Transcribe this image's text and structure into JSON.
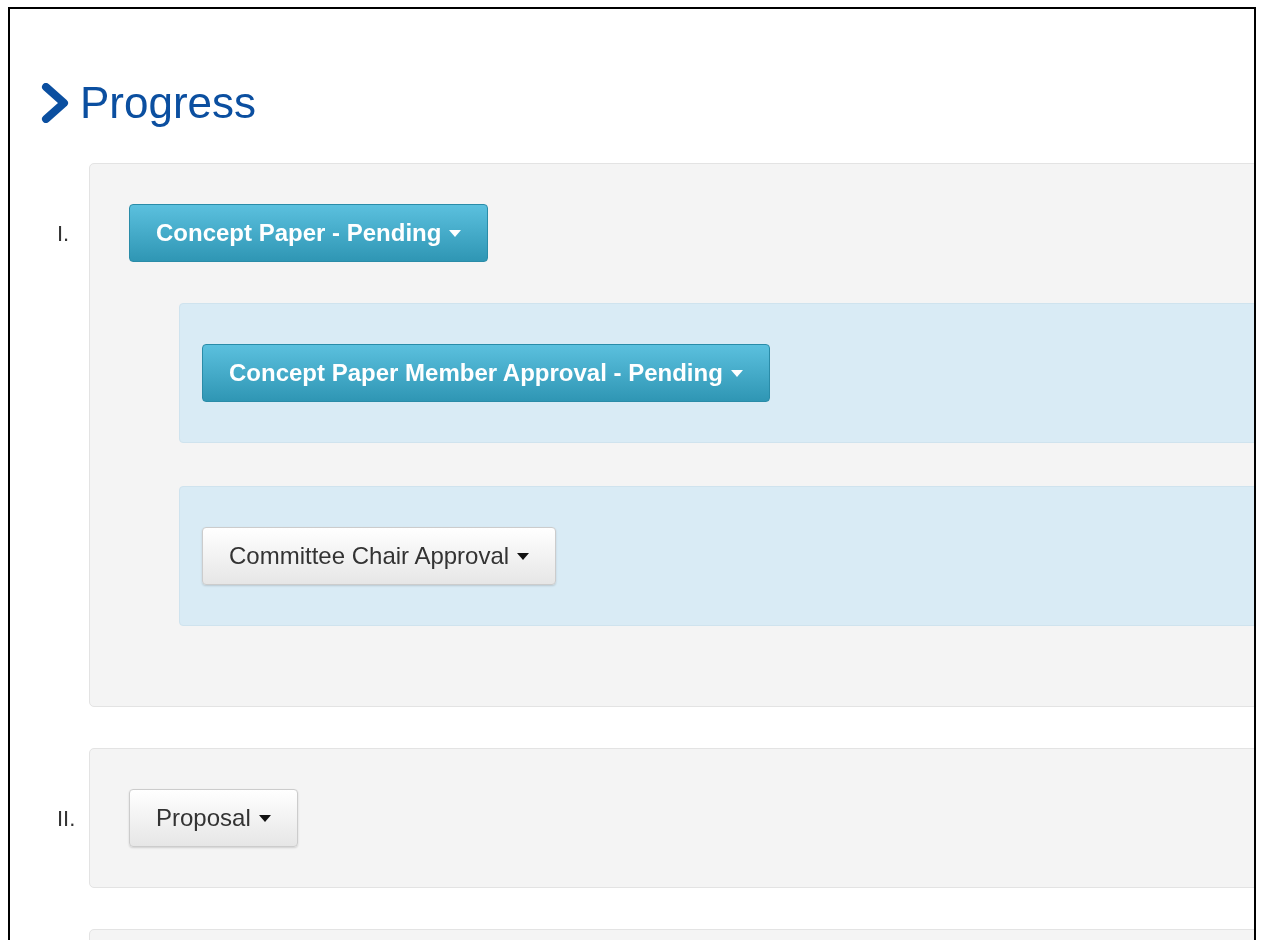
{
  "heading": "Progress",
  "stages": [
    {
      "numeral": "I.",
      "label": "Concept Paper - Pending",
      "kind": "info",
      "substeps": [
        {
          "label": "Concept Paper Member Approval - Pending",
          "kind": "info"
        },
        {
          "label": "Committee Chair Approval",
          "kind": "default"
        }
      ]
    },
    {
      "numeral": "II.",
      "label": "Proposal",
      "kind": "default"
    }
  ]
}
